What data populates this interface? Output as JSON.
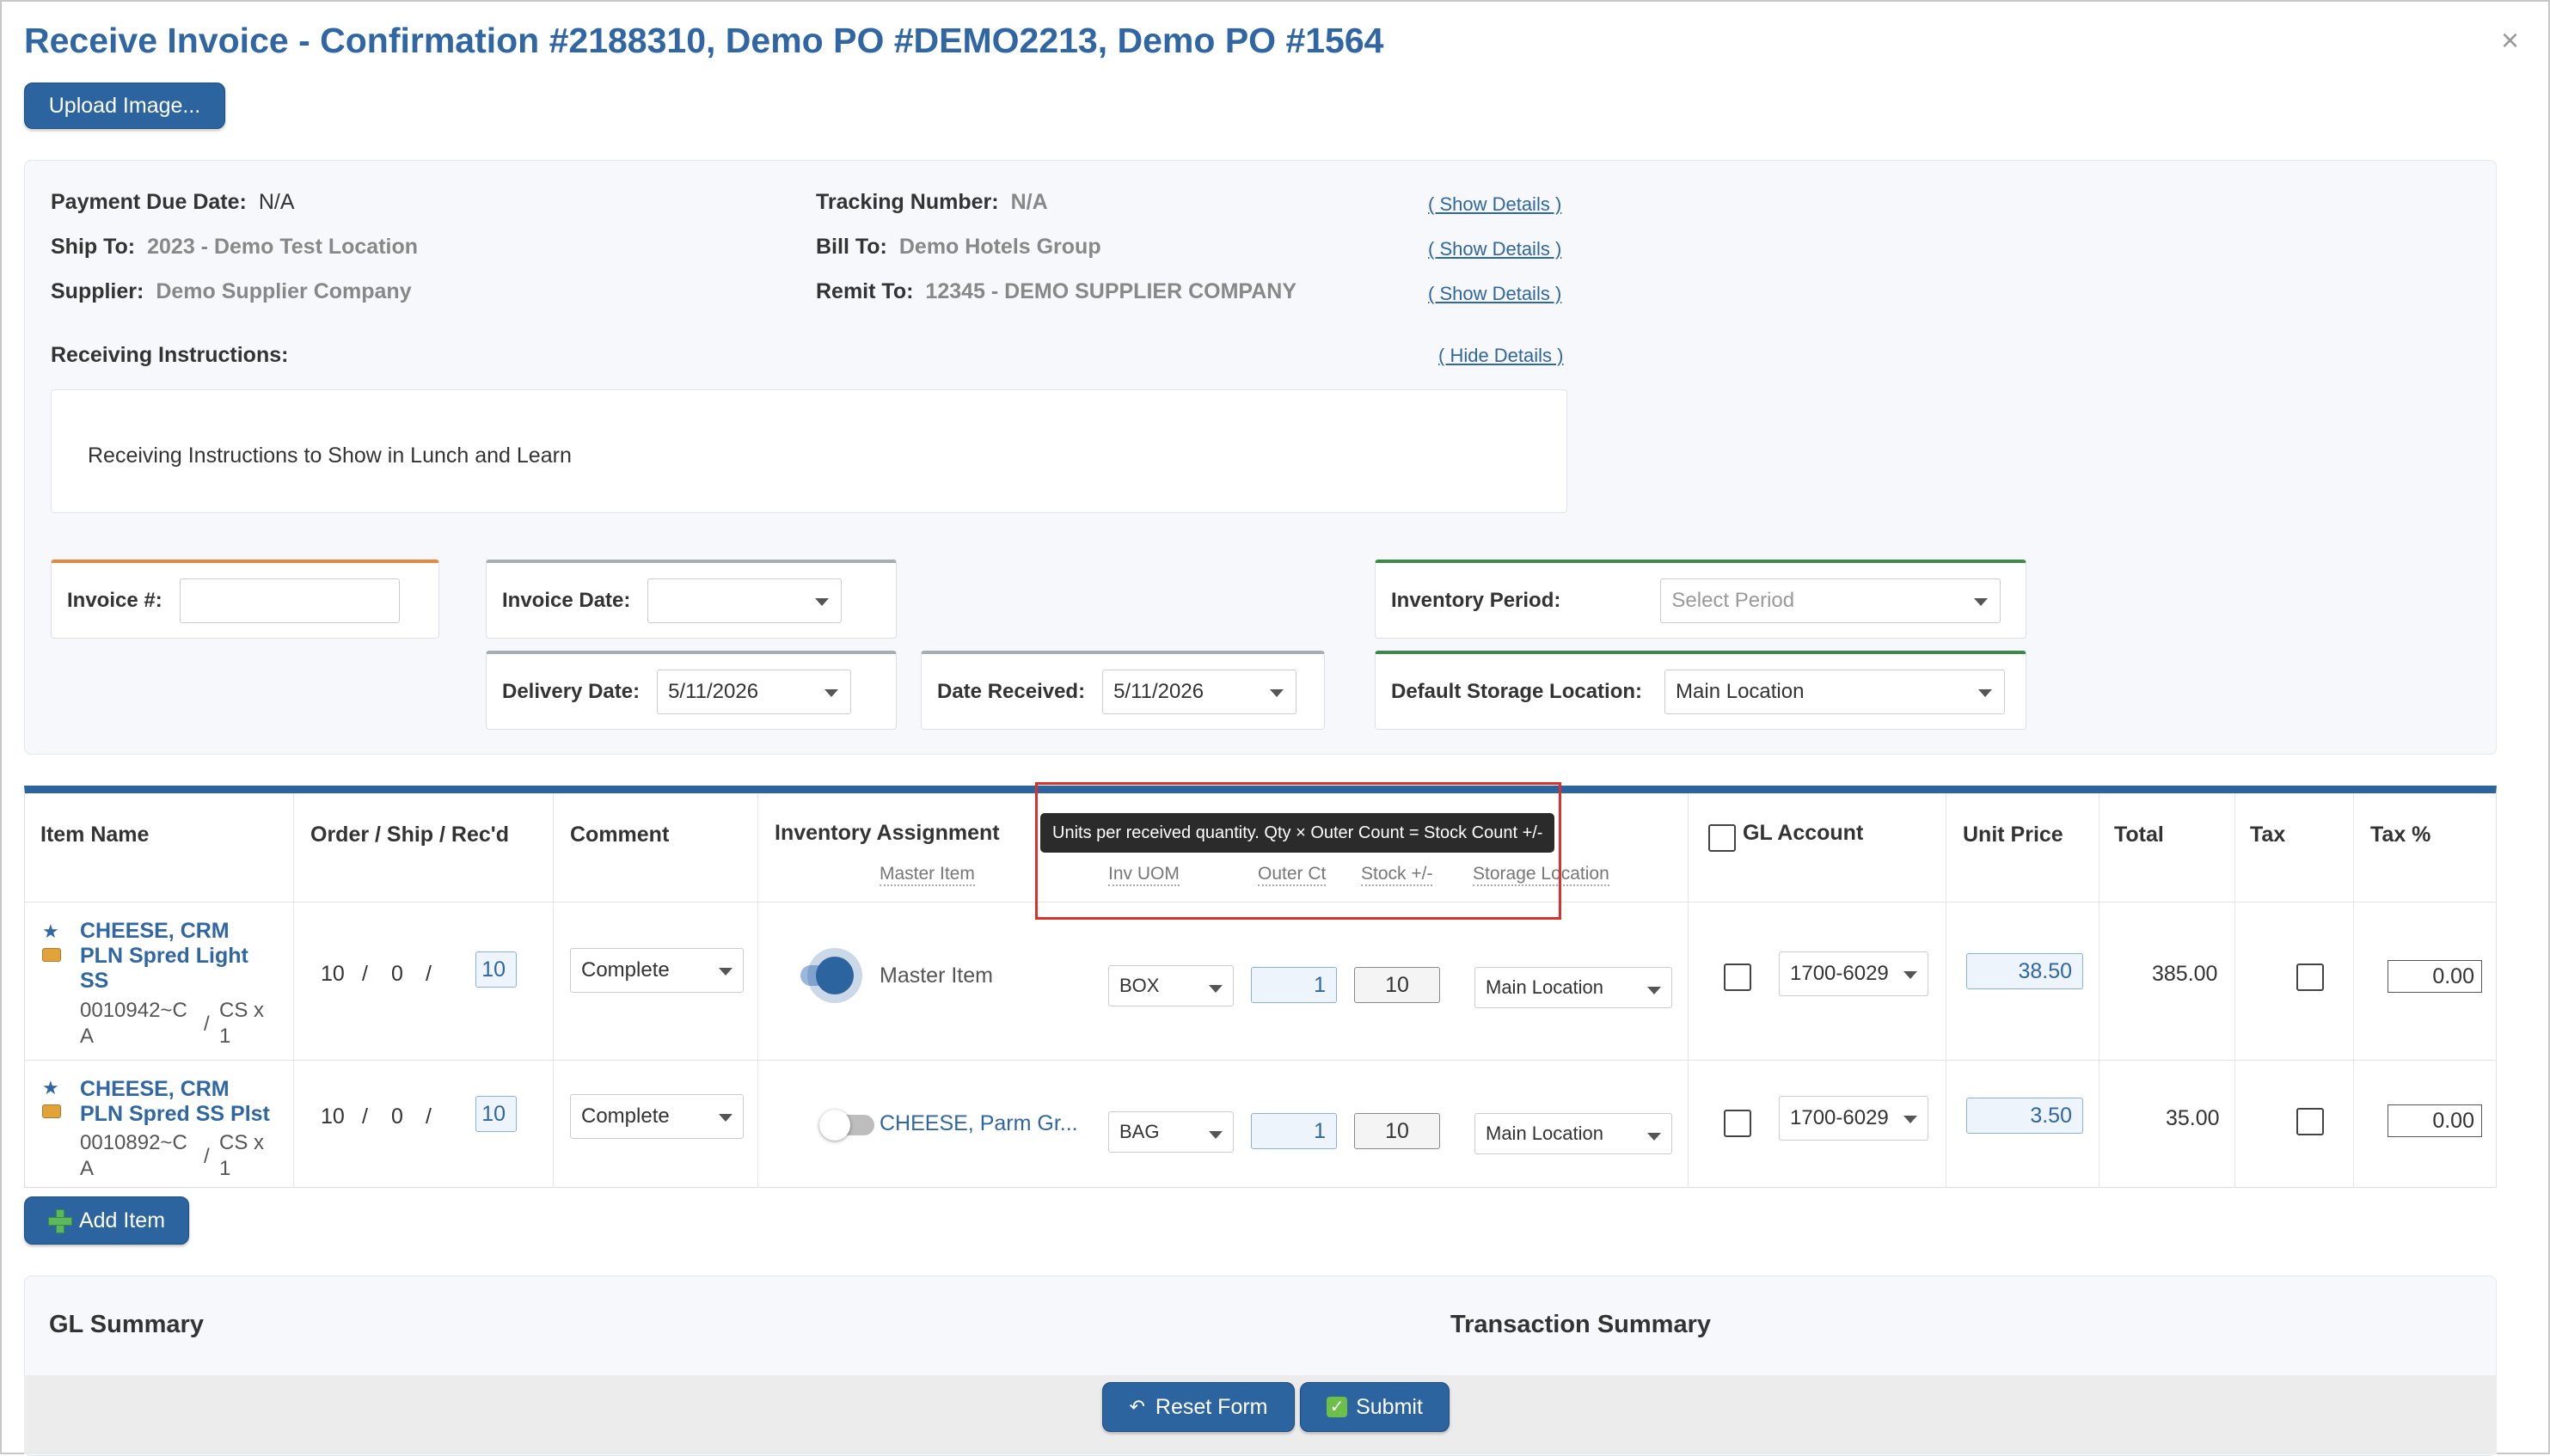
{
  "title": "Receive Invoice - Confirmation #2188310, Demo PO #DEMO2213, Demo PO #1564",
  "close_icon": "×",
  "upload_label": "Upload Image...",
  "details": {
    "payment_due_label": "Payment Due Date:",
    "payment_due_value": "N/A",
    "ship_to_label": "Ship To:",
    "ship_to_value": "2023 - Demo Test Location",
    "supplier_label": "Supplier:",
    "supplier_value": "Demo Supplier Company",
    "tracking_label": "Tracking Number:",
    "tracking_value": "N/A",
    "bill_to_label": "Bill To:",
    "bill_to_value": "Demo Hotels Group",
    "remit_to_label": "Remit To:",
    "remit_to_value": "12345 - DEMO SUPPLIER COMPANY",
    "show_details": "( Show Details )",
    "hide_details": "( Hide Details )",
    "receiving_instructions_label": "Receiving Instructions:",
    "receiving_instructions_text": "Receiving Instructions to Show in Lunch and Learn"
  },
  "fields": {
    "invoice_no_label": "Invoice #:",
    "invoice_no_value": "",
    "invoice_date_label": "Invoice Date:",
    "invoice_date_value": "",
    "delivery_date_label": "Delivery Date:",
    "delivery_date_value": "5/11/2026",
    "date_received_label": "Date Received:",
    "date_received_value": "5/11/2026",
    "inventory_period_label": "Inventory Period:",
    "inventory_period_placeholder": "Select Period",
    "default_storage_label": "Default Storage Location:",
    "default_storage_value": "Main Location"
  },
  "table": {
    "headers": {
      "item_name": "Item Name",
      "order_ship": "Order / Ship / Rec'd",
      "comment": "Comment",
      "inventory_assignment": "Inventory Assignment",
      "gl_account": "GL Account",
      "unit_price": "Unit Price",
      "total": "Total",
      "tax": "Tax",
      "tax_pct": "Tax %"
    },
    "sub_headers": {
      "master_item": "Master Item",
      "inv_uom": "Inv UOM",
      "outer_ct": "Outer Ct",
      "stock": "Stock +/-",
      "storage_location": "Storage Location"
    },
    "tooltip": "Units per received quantity. Qty × Outer Count = Stock Count +/-",
    "rows": [
      {
        "name_line1": "CHEESE, CRM",
        "name_line2": "PLN Spred Light",
        "name_line3": "SS",
        "code_line1": "0010942~C",
        "code_line2": "A",
        "sep": "/",
        "pack_line1": "CS x",
        "pack_line2": "1",
        "order": "10",
        "ship": "0",
        "recd": "10",
        "comment": "Complete",
        "assignment": "Master Item",
        "uom": "BOX",
        "outer_ct": "1",
        "stock": "10",
        "storage": "Main Location",
        "gl": "1700-6029",
        "unit_price": "38.50",
        "total": "385.00",
        "tax_pct": "0.00"
      },
      {
        "name_line1": "CHEESE, CRM",
        "name_line2": "PLN Spred SS Plst",
        "name_line3": "",
        "code_line1": "0010892~C",
        "code_line2": "A",
        "sep": "/",
        "pack_line1": "CS x",
        "pack_line2": "1",
        "order": "10",
        "ship": "0",
        "recd": "10",
        "comment": "Complete",
        "assignment": "CHEESE, Parm Gr...",
        "uom": "BAG",
        "outer_ct": "1",
        "stock": "10",
        "storage": "Main Location",
        "gl": "1700-6029",
        "unit_price": "3.50",
        "total": "35.00",
        "tax_pct": "0.00"
      }
    ]
  },
  "add_item_label": "Add Item",
  "gl_summary_title": "GL Summary",
  "transaction_summary_title": "Transaction Summary",
  "reset_label": "Reset Form",
  "submit_label": "Submit",
  "colors": {
    "primary": "#2c64a0",
    "orange_accent": "#e8863a",
    "green_accent": "#3b8a4a",
    "gray_accent": "#a7adb4",
    "highlight_red": "#d9322a"
  }
}
